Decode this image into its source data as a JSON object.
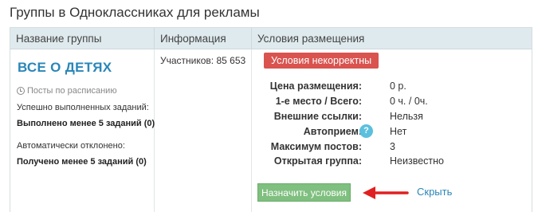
{
  "page": {
    "title": "Группы в Одноклассниках для рекламы"
  },
  "table": {
    "headers": [
      "Название группы",
      "Информация",
      "Условия размещения"
    ],
    "group": {
      "name": "ВСЕ О ДЕТЯХ",
      "schedule": "Посты по расписанию",
      "completed_label": "Успешно выполненных заданий:",
      "completed_value": "Выполнено менее 5 заданий (0)",
      "rejected_label": "Автоматически отклонено:",
      "rejected_value": "Получено менее 5 заданий (0)"
    },
    "info": {
      "participants": "Участников: 85 653"
    },
    "conditions": {
      "status_badge": "Условия некорректны",
      "rows": [
        {
          "label": "Цена размещения:",
          "value": "0 р."
        },
        {
          "label": "1-е место / Всего:",
          "value": "0 ч. / 0ч."
        },
        {
          "label": "Внешние ссылки:",
          "value": "Нельзя"
        },
        {
          "label": "Автоприем:",
          "value": "Нет"
        },
        {
          "label": "Максимум постов:",
          "value": "3"
        },
        {
          "label": "Открытая группа:",
          "value": "Неизвестно"
        }
      ],
      "help_icon": "?",
      "assign_button": "Назначить условия",
      "hide_link": "Скрыть"
    }
  },
  "colors": {
    "header_bg": "#dfeaee",
    "link": "#2a86b8",
    "badge": "#d9534f",
    "button": "#7fbf7f",
    "arrow": "#e02020",
    "help": "#5bc0de"
  },
  "icons": {
    "schedule": "clock-icon",
    "help": "question-icon",
    "pointer": "red-arrow-icon"
  }
}
